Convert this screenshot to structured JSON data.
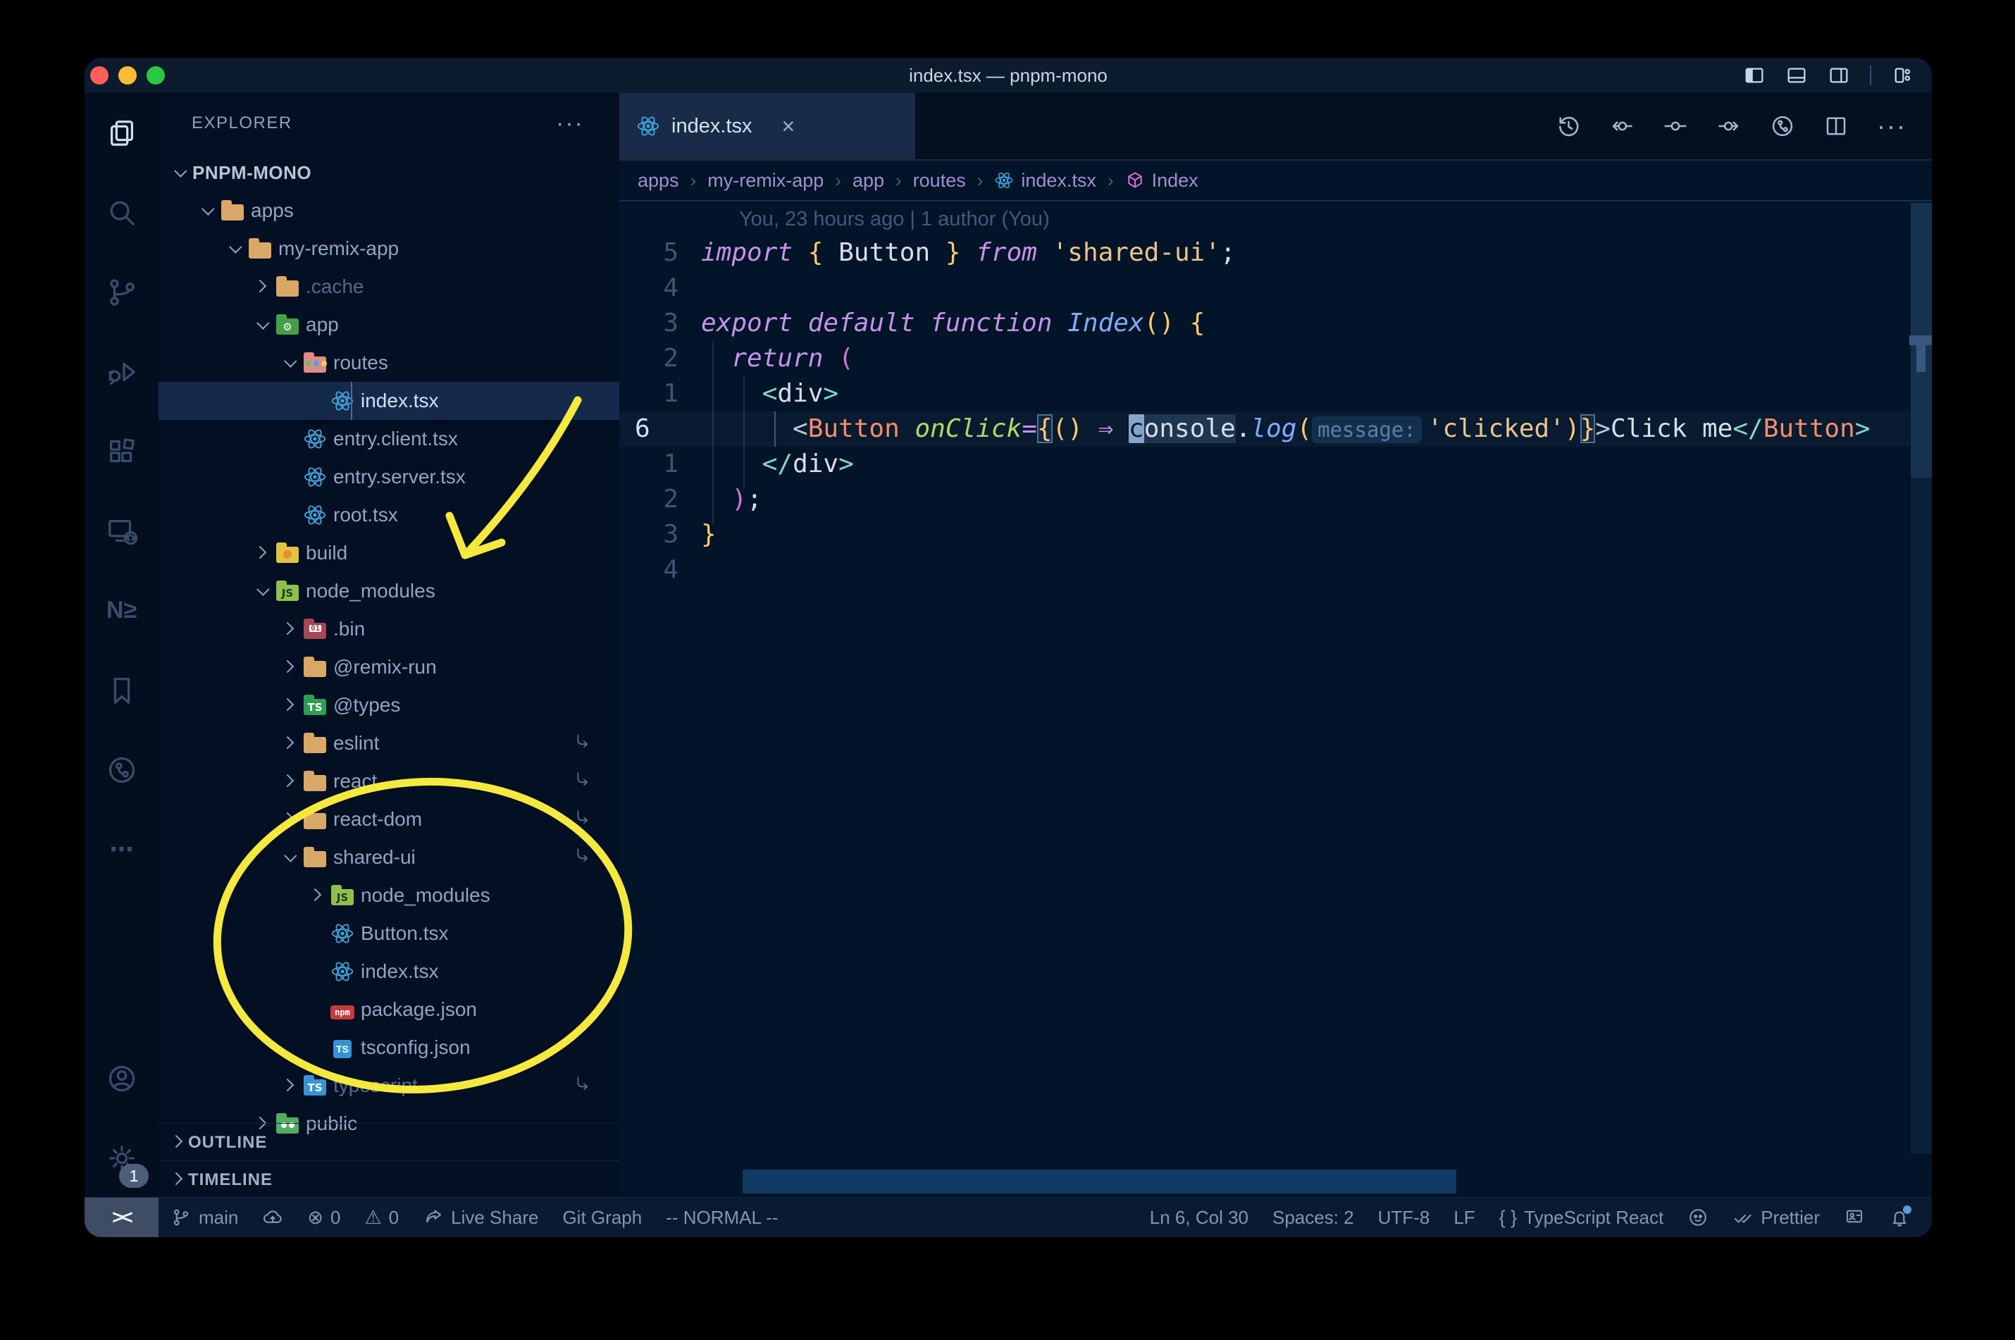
{
  "window": {
    "title": "index.tsx — pnpm-mono"
  },
  "colors": {
    "traffic_red": "#ff5f57",
    "traffic_yellow": "#febc2e",
    "traffic_green": "#28c840",
    "annotation_yellow": "#f6e93d",
    "selection_blue": "#152a4a",
    "editor_bg": "#021428",
    "react_blue": "#3fa7e0",
    "folder_tan": "#d9a766"
  },
  "activity_bar": {
    "items": [
      {
        "name": "explorer",
        "active": true
      },
      {
        "name": "search",
        "active": false
      },
      {
        "name": "source-control",
        "active": false
      },
      {
        "name": "run-debug",
        "active": false
      },
      {
        "name": "extensions",
        "active": false
      },
      {
        "name": "remote-explorer",
        "active": false
      },
      {
        "name": "nx-console",
        "active": false
      },
      {
        "name": "bookmarks",
        "active": false
      },
      {
        "name": "gitlens",
        "active": false
      },
      {
        "name": "more",
        "active": false
      }
    ],
    "bottom": [
      {
        "name": "account"
      },
      {
        "name": "settings",
        "badge": "1"
      }
    ]
  },
  "sidebar": {
    "header": "EXPLORER",
    "header_more": "···",
    "root": "PNPM-MONO",
    "tree": [
      {
        "label": "apps",
        "level": 1,
        "kind": "folder",
        "icon": "tan",
        "expanded": true
      },
      {
        "label": "my-remix-app",
        "level": 2,
        "kind": "folder",
        "icon": "tan",
        "expanded": true
      },
      {
        "label": ".cache",
        "level": 3,
        "kind": "folder",
        "icon": "tan",
        "expanded": false,
        "dim": true
      },
      {
        "label": "app",
        "level": 3,
        "kind": "folder",
        "icon": "app",
        "expanded": true
      },
      {
        "label": "routes",
        "level": 4,
        "kind": "folder",
        "icon": "routes",
        "expanded": true
      },
      {
        "label": "index.tsx",
        "level": 5,
        "kind": "file",
        "icon": "react",
        "selected": true
      },
      {
        "label": "entry.client.tsx",
        "level": 4,
        "kind": "file",
        "icon": "react"
      },
      {
        "label": "entry.server.tsx",
        "level": 4,
        "kind": "file",
        "icon": "react"
      },
      {
        "label": "root.tsx",
        "level": 4,
        "kind": "file",
        "icon": "react"
      },
      {
        "label": "build",
        "level": 3,
        "kind": "folder",
        "icon": "build",
        "expanded": false
      },
      {
        "label": "node_modules",
        "level": 3,
        "kind": "folder",
        "icon": "node",
        "expanded": true
      },
      {
        "label": ".bin",
        "level": 4,
        "kind": "folder",
        "icon": "bin",
        "expanded": false
      },
      {
        "label": "@remix-run",
        "level": 4,
        "kind": "folder",
        "icon": "tan",
        "expanded": false
      },
      {
        "label": "@types",
        "level": 4,
        "kind": "folder",
        "icon": "types",
        "expanded": false
      },
      {
        "label": "eslint",
        "level": 4,
        "kind": "folder",
        "icon": "tan",
        "expanded": false,
        "symlink": true
      },
      {
        "label": "react",
        "level": 4,
        "kind": "folder",
        "icon": "tan",
        "expanded": false,
        "symlink": true
      },
      {
        "label": "react-dom",
        "level": 4,
        "kind": "folder",
        "icon": "tan",
        "expanded": false,
        "symlink": true
      },
      {
        "label": "shared-ui",
        "level": 4,
        "kind": "folder",
        "icon": "tan",
        "expanded": true,
        "symlink": true
      },
      {
        "label": "node_modules",
        "level": 5,
        "kind": "folder",
        "icon": "node",
        "expanded": false
      },
      {
        "label": "Button.tsx",
        "level": 5,
        "kind": "file",
        "icon": "react"
      },
      {
        "label": "index.tsx",
        "level": 5,
        "kind": "file",
        "icon": "react"
      },
      {
        "label": "package.json",
        "level": 5,
        "kind": "file",
        "icon": "npm"
      },
      {
        "label": "tsconfig.json",
        "level": 5,
        "kind": "file",
        "icon": "tsjson"
      },
      {
        "label": "typescript",
        "level": 4,
        "kind": "folder",
        "icon": "tsblue",
        "expanded": false,
        "dim": true,
        "symlink": true
      },
      {
        "label": "public",
        "level": 3,
        "kind": "folder",
        "icon": "public",
        "expanded": false
      }
    ],
    "sections": [
      "OUTLINE",
      "TIMELINE"
    ]
  },
  "editor": {
    "tab": {
      "label": "index.tsx",
      "icon": "react",
      "close": "×"
    },
    "actions": [
      "history",
      "commit-prev",
      "commit",
      "commit-next",
      "graph",
      "split-editor",
      "more-dots"
    ],
    "breadcrumbs": [
      {
        "label": "apps"
      },
      {
        "label": "my-remix-app"
      },
      {
        "label": "app"
      },
      {
        "label": "routes"
      },
      {
        "label": "index.tsx",
        "icon": "react"
      },
      {
        "label": "Index",
        "icon": "symbol-cube"
      }
    ],
    "blame": "You, 23 hours ago | 1 author (You)",
    "lines": [
      {
        "num": "5",
        "tokens": [
          [
            "import",
            "kw"
          ],
          [
            " ",
            "fg"
          ],
          [
            "{",
            "b1"
          ],
          [
            " ",
            "fg"
          ],
          [
            "Button",
            "fg"
          ],
          [
            " ",
            "fg"
          ],
          [
            "}",
            "b1"
          ],
          [
            " ",
            "fg"
          ],
          [
            "from",
            "kw"
          ],
          [
            " ",
            "fg"
          ],
          [
            "'shared-ui'",
            "str"
          ],
          [
            ";",
            "fg"
          ]
        ]
      },
      {
        "num": "4",
        "tokens": []
      },
      {
        "num": "3",
        "tokens": [
          [
            "export",
            "kw"
          ],
          [
            " ",
            "fg"
          ],
          [
            "default",
            "kw"
          ],
          [
            " ",
            "fg"
          ],
          [
            "function",
            "kw"
          ],
          [
            " ",
            "fg"
          ],
          [
            "Index",
            "fn"
          ],
          [
            "(",
            "b1"
          ],
          [
            ")",
            "b1"
          ],
          [
            " ",
            "fg"
          ],
          [
            "{",
            "b1"
          ]
        ]
      },
      {
        "num": "2",
        "tokens": [
          [
            "  ",
            "fg"
          ],
          [
            "return",
            "kw"
          ],
          [
            " ",
            "fg"
          ],
          [
            "(",
            "b2"
          ]
        ]
      },
      {
        "num": "1",
        "tokens": [
          [
            "    ",
            "fg"
          ],
          [
            "<",
            "tagp"
          ],
          [
            "div",
            "tagn"
          ],
          [
            ">",
            "tagp"
          ]
        ]
      },
      {
        "num": "6",
        "current": true,
        "tokens": [
          [
            "      ",
            "fg"
          ],
          [
            "<",
            "tagb"
          ],
          [
            "Button",
            "comp"
          ],
          [
            " ",
            "fg"
          ],
          [
            "onClick",
            "attr"
          ],
          [
            "=",
            "op"
          ],
          [
            "{",
            "b1 mb"
          ],
          [
            "(",
            "b1"
          ],
          [
            ")",
            "b1"
          ],
          [
            " ",
            "fg"
          ],
          [
            "⇒",
            "kw"
          ],
          [
            " ",
            "fg"
          ],
          [
            "c",
            "cur"
          ],
          [
            "onsole",
            "fg whl"
          ],
          [
            ".",
            "fg"
          ],
          [
            "log",
            "fn"
          ],
          [
            "(",
            "b1"
          ],
          [
            "message:",
            "inlay"
          ],
          [
            "'clicked'",
            "str"
          ],
          [
            ")",
            "b1"
          ],
          [
            "}",
            "b1 mb"
          ],
          [
            ">",
            "tagb"
          ],
          [
            "Click me",
            "fg"
          ],
          [
            "</",
            "tagp"
          ],
          [
            "Button",
            "comp"
          ],
          [
            ">",
            "tagp"
          ]
        ]
      },
      {
        "num": "1",
        "tokens": [
          [
            "    ",
            "fg"
          ],
          [
            "</",
            "tagp"
          ],
          [
            "div",
            "tagn"
          ],
          [
            ">",
            "tagp"
          ]
        ]
      },
      {
        "num": "2",
        "tokens": [
          [
            "  ",
            "fg"
          ],
          [
            ")",
            "b2"
          ],
          [
            ";",
            "fg"
          ]
        ]
      },
      {
        "num": "3",
        "tokens": [
          [
            "}",
            "b1"
          ]
        ]
      },
      {
        "num": "4",
        "tokens": []
      }
    ]
  },
  "status_bar": {
    "left": [
      {
        "name": "remote",
        "label": "><",
        "remote": true
      },
      {
        "name": "git-branch",
        "icon": "branch",
        "label": "main"
      },
      {
        "name": "sync",
        "icon": "cloud-upload",
        "label": ""
      },
      {
        "name": "errors",
        "icon": "error",
        "label": "0"
      },
      {
        "name": "warnings",
        "icon": "warning",
        "label": "0"
      },
      {
        "name": "live-share",
        "icon": "live-share",
        "label": "Live Share"
      },
      {
        "name": "git-graph",
        "label": "Git Graph"
      },
      {
        "name": "vim-mode",
        "label": "-- NORMAL --"
      }
    ],
    "right": [
      {
        "name": "cursor-position",
        "label": "Ln 6, Col 30"
      },
      {
        "name": "indentation",
        "label": "Spaces: 2"
      },
      {
        "name": "encoding",
        "label": "UTF-8"
      },
      {
        "name": "eol",
        "label": "LF"
      },
      {
        "name": "language-mode",
        "icon": "brackets",
        "label": "TypeScript React"
      },
      {
        "name": "extension-octoface",
        "icon": "octoface",
        "label": ""
      },
      {
        "name": "formatter-prettier",
        "icon": "double-check",
        "label": "Prettier"
      },
      {
        "name": "feedback",
        "icon": "feedback",
        "label": ""
      },
      {
        "name": "notifications",
        "icon": "bell",
        "label": "",
        "dot": true
      }
    ]
  },
  "window_controls": [
    "toggle-sidebar",
    "toggle-panel",
    "toggle-secondary-sidebar",
    "customize-layout"
  ]
}
